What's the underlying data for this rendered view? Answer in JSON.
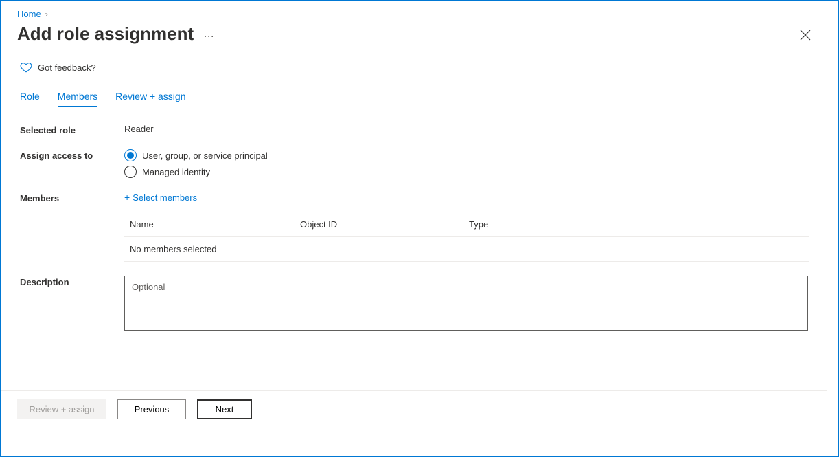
{
  "breadcrumb": {
    "home": "Home"
  },
  "title": "Add role assignment",
  "feedback": {
    "label": "Got feedback?"
  },
  "tabs": {
    "role": "Role",
    "members": "Members",
    "review": "Review + assign"
  },
  "form": {
    "selected_role_label": "Selected role",
    "selected_role_value": "Reader",
    "assign_label": "Assign access to",
    "assign_options": {
      "user": "User, group, or service principal",
      "managed": "Managed identity"
    },
    "members_label": "Members",
    "select_members_link": "Select members",
    "table": {
      "col_name": "Name",
      "col_object": "Object ID",
      "col_type": "Type",
      "empty": "No members selected"
    },
    "description_label": "Description",
    "description_placeholder": "Optional"
  },
  "footer": {
    "review": "Review + assign",
    "previous": "Previous",
    "next": "Next"
  }
}
